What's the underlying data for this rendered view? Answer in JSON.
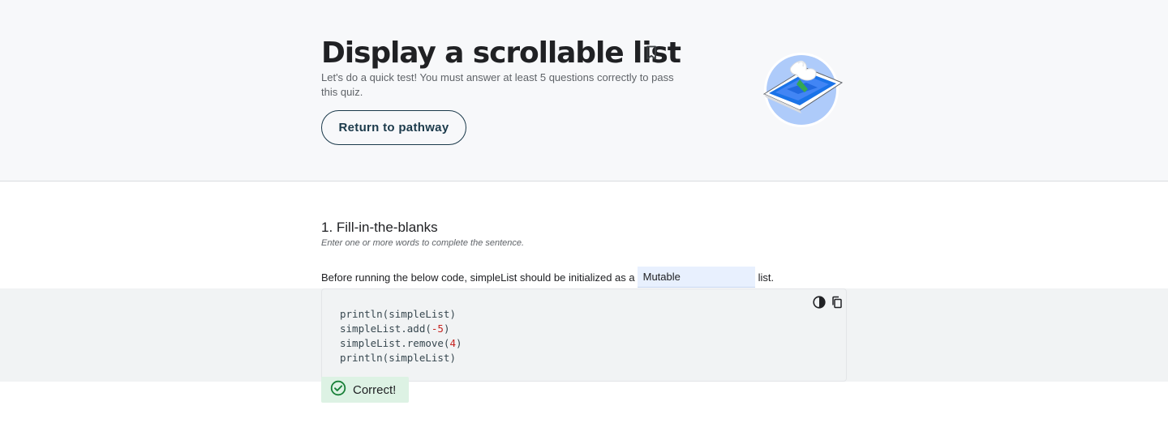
{
  "header": {
    "title": "Display a scrollable list",
    "bookmark_icon": "bookmark-icon",
    "subtitle": "Let's do a quick test! You must answer at least 5 questions correctly to pass this quiz.",
    "return_button": "Return to pathway"
  },
  "question": {
    "title": "1. Fill-in-the-blanks",
    "hint": "Enter one or more words to complete the sentence.",
    "sentence_before": "Before running the below code, simpleList should be initialized as a",
    "answer_value": "Mutable",
    "sentence_after": "list.",
    "code": {
      "line1": "println(simpleList)",
      "line2_pre": "simpleList.add(",
      "line2_num": "-5",
      "line2_post": ")",
      "line3_pre": "simpleList.remove(",
      "line3_num": "4",
      "line3_post": ")",
      "line4": "println(simpleList)"
    },
    "result": "Correct!"
  },
  "colors": {
    "hero_bg": "#f7f8fa",
    "button_border": "#1b3a4b",
    "input_bg": "#e8f0fe",
    "code_bg": "#f1f3f4",
    "success_bg": "#ddf2e4",
    "success_icon": "#188038"
  }
}
